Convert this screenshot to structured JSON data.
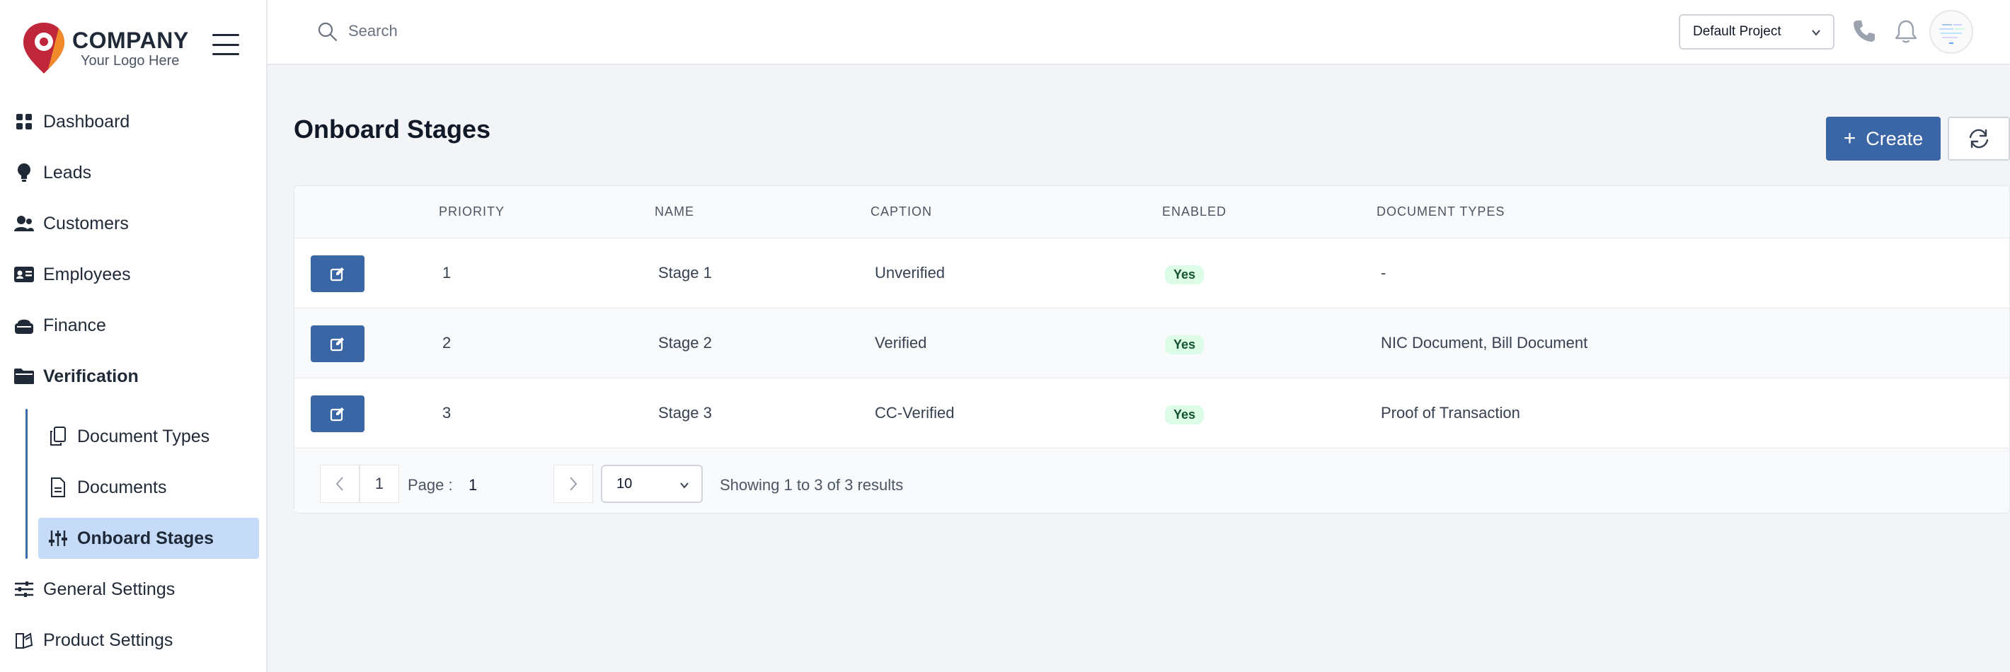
{
  "brand": {
    "company": "COMPANY",
    "tagline": "Your Logo Here",
    "colors": {
      "logo_red": "#c0263a",
      "logo_orange": "#f08a2a",
      "accent": "#3b66a5",
      "active_bg": "#c5dbf7"
    }
  },
  "sidebar": {
    "items": [
      {
        "label": "Dashboard",
        "icon": "grid-icon"
      },
      {
        "label": "Leads",
        "icon": "lightbulb-icon"
      },
      {
        "label": "Customers",
        "icon": "users-icon"
      },
      {
        "label": "Employees",
        "icon": "id-card-icon"
      },
      {
        "label": "Finance",
        "icon": "piggy-bank-icon"
      },
      {
        "label": "Verification",
        "icon": "folder-open-icon"
      },
      {
        "label": "General Settings",
        "icon": "sliders-icon"
      },
      {
        "label": "Product Settings",
        "icon": "box-icon"
      }
    ],
    "submenu": [
      {
        "label": "Document Types",
        "icon": "copy-icon"
      },
      {
        "label": "Documents",
        "icon": "file-icon"
      },
      {
        "label": "Onboard Stages",
        "icon": "tune-icon"
      }
    ]
  },
  "header": {
    "search_placeholder": "Search",
    "project": "Default Project"
  },
  "main": {
    "title": "Onboard Stages",
    "create_label": "Create",
    "columns": [
      "PRIORITY",
      "NAME",
      "CAPTION",
      "ENABLED",
      "DOCUMENT TYPES"
    ],
    "rows": [
      {
        "priority": "1",
        "name": "Stage 1",
        "caption": "Unverified",
        "enabled": "Yes",
        "document_types": "-"
      },
      {
        "priority": "2",
        "name": "Stage 2",
        "caption": "Verified",
        "enabled": "Yes",
        "document_types": "NIC Document, Bill Document"
      },
      {
        "priority": "3",
        "name": "Stage 3",
        "caption": "CC-Verified",
        "enabled": "Yes",
        "document_types": "Proof of Transaction"
      }
    ],
    "pagination": {
      "current": "1",
      "page_label": "Page :",
      "page_value": "1",
      "page_size": "10",
      "summary": "Showing 1 to 3 of 3 results"
    }
  }
}
